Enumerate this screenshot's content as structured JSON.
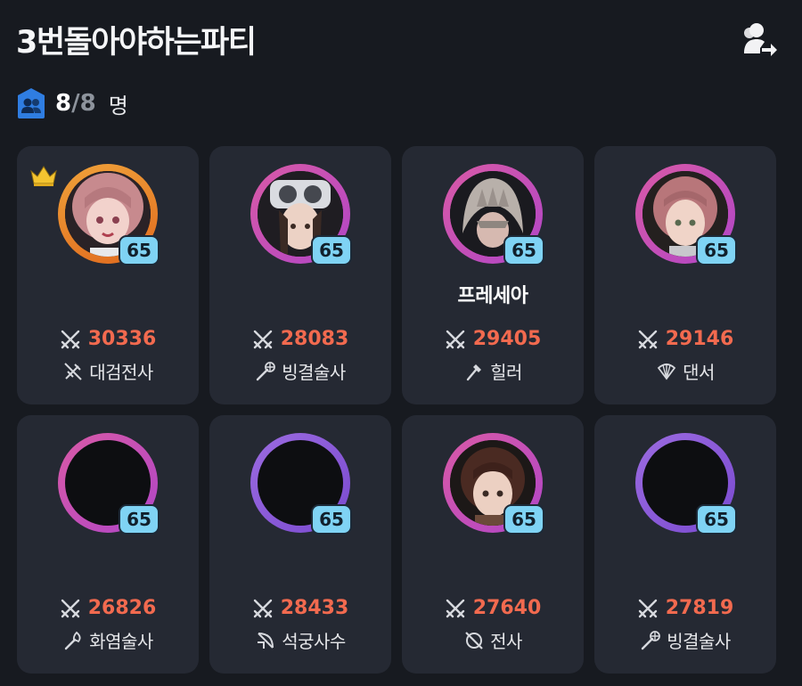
{
  "header": {
    "title": "3번돌아야하는파티"
  },
  "party_count": {
    "current": "8",
    "separator": "/",
    "max": "8",
    "unit": "명"
  },
  "members": [
    {
      "name": "",
      "level": "65",
      "power": "30336",
      "class_label": "대검전사",
      "class_icon": "greatsword-icon",
      "is_leader": true
    },
    {
      "name": "",
      "level": "65",
      "power": "28083",
      "class_label": "빙결술사",
      "class_icon": "frost-staff-icon",
      "is_leader": false
    },
    {
      "name": "프레세아",
      "level": "65",
      "power": "29405",
      "class_label": "힐러",
      "class_icon": "healer-wand-icon",
      "is_leader": false
    },
    {
      "name": "",
      "level": "65",
      "power": "29146",
      "class_label": "댄서",
      "class_icon": "fan-icon",
      "is_leader": false
    },
    {
      "name": "",
      "level": "65",
      "power": "26826",
      "class_label": "화염술사",
      "class_icon": "flame-staff-icon",
      "is_leader": false
    },
    {
      "name": "",
      "level": "65",
      "power": "28433",
      "class_label": "석궁사수",
      "class_icon": "crossbow-icon",
      "is_leader": false
    },
    {
      "name": "",
      "level": "65",
      "power": "27640",
      "class_label": "전사",
      "class_icon": "sword-shield-icon",
      "is_leader": false
    },
    {
      "name": "",
      "level": "65",
      "power": "27819",
      "class_label": "빙결술사",
      "class_icon": "frost-staff-icon",
      "is_leader": false
    }
  ],
  "colors": {
    "background": "#171a20",
    "card": "#252933",
    "power_text": "#f26a4f",
    "level_badge": "#7fd3f4",
    "ring_pink": "#d95aa6",
    "ring_orange": "#f0a23a",
    "ring_purple": "#9b6be0",
    "party_icon": "#2f7de1"
  }
}
